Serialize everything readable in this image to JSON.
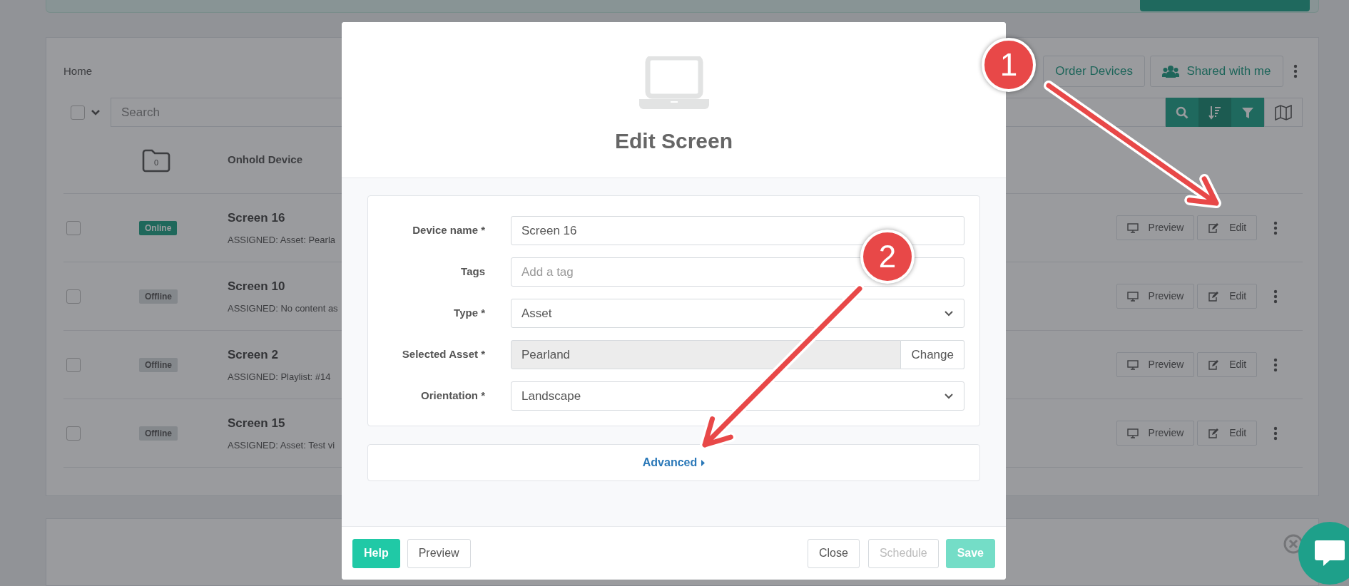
{
  "breadcrumb": "Home",
  "header_buttons": [
    {
      "label": "Order Devices",
      "kind": "plain"
    },
    {
      "label": "Shared with me",
      "kind": "users"
    }
  ],
  "search": {
    "placeholder": "Search",
    "select_all_checked": false
  },
  "folder": {
    "count": "0",
    "name": "Onhold Device"
  },
  "devices": [
    {
      "name": "Screen 16",
      "status": "Online",
      "online": true,
      "checked": false,
      "assigned": "ASSIGNED: Asset: Pearla",
      "preview": "Preview",
      "edit": "Edit"
    },
    {
      "name": "Screen 10",
      "status": "Offline",
      "online": false,
      "checked": false,
      "assigned": "ASSIGNED: No content as",
      "preview": "Preview",
      "edit": "Edit"
    },
    {
      "name": "Screen 2",
      "status": "Offline",
      "online": false,
      "checked": false,
      "assigned": "ASSIGNED: Playlist: #14",
      "preview": "Preview",
      "edit": "Edit"
    },
    {
      "name": "Screen 15",
      "status": "Offline",
      "online": false,
      "checked": false,
      "assigned": "ASSIGNED: Asset: Test vi",
      "preview": "Preview",
      "edit": "Edit"
    }
  ],
  "modal": {
    "title": "Edit Screen",
    "fields": [
      {
        "label": "Device name *",
        "kind": "text",
        "value": "Screen 16"
      },
      {
        "label": "Tags",
        "kind": "tags",
        "placeholder": "Add a tag"
      },
      {
        "label": "Type *",
        "kind": "select",
        "value": "Asset"
      },
      {
        "label": "Selected Asset *",
        "kind": "asset",
        "value": "Pearland",
        "button": "Change"
      },
      {
        "label": "Orientation *",
        "kind": "select",
        "value": "Landscape"
      }
    ],
    "advanced": "Advanced",
    "buttons": [
      {
        "label": "Help",
        "kind": "help",
        "disabled": false
      },
      {
        "label": "Preview",
        "kind": "plain",
        "disabled": false
      },
      {
        "label": "Close",
        "kind": "plain",
        "disabled": false
      },
      {
        "label": "Schedule",
        "kind": "plain",
        "disabled": true
      },
      {
        "label": "Save",
        "kind": "save",
        "disabled": true
      }
    ]
  },
  "annotations": [
    {
      "number": "1"
    },
    {
      "number": "2"
    }
  ]
}
